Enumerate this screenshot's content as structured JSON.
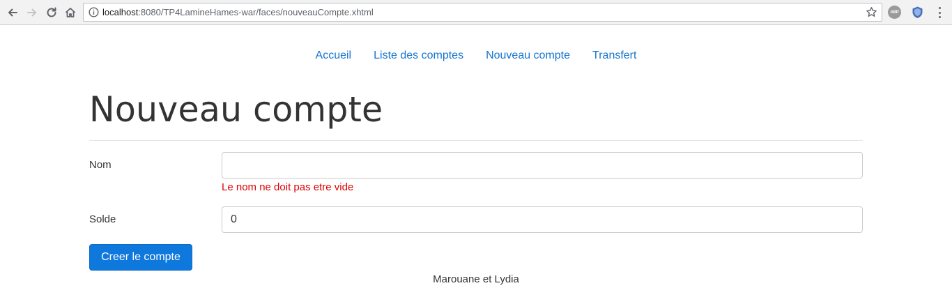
{
  "browser": {
    "url_host": "localhost",
    "url_rest": ":8080/TP4LamineHames-war/faces/nouveauCompte.xhtml",
    "extensions": {
      "abp_label": "ABP"
    },
    "icons": [
      "back-arrow-icon",
      "forward-arrow-icon",
      "reload-icon",
      "home-icon",
      "info-icon",
      "star-icon",
      "abp-icon",
      "shield-extension-icon",
      "menu-dots-icon"
    ]
  },
  "nav": {
    "items": [
      {
        "label": "Accueil"
      },
      {
        "label": "Liste des comptes"
      },
      {
        "label": "Nouveau compte"
      },
      {
        "label": "Transfert"
      }
    ]
  },
  "page": {
    "title": "Nouveau compte"
  },
  "form": {
    "nom": {
      "label": "Nom",
      "value": "",
      "error": "Le nom ne doit pas etre vide"
    },
    "solde": {
      "label": "Solde",
      "value": "0"
    },
    "submit_label": "Creer le compte"
  },
  "footer": {
    "text": "Marouane et Lydia"
  },
  "colors": {
    "link": "#1474d0",
    "error": "#e00000",
    "button": "#0f78dc"
  }
}
